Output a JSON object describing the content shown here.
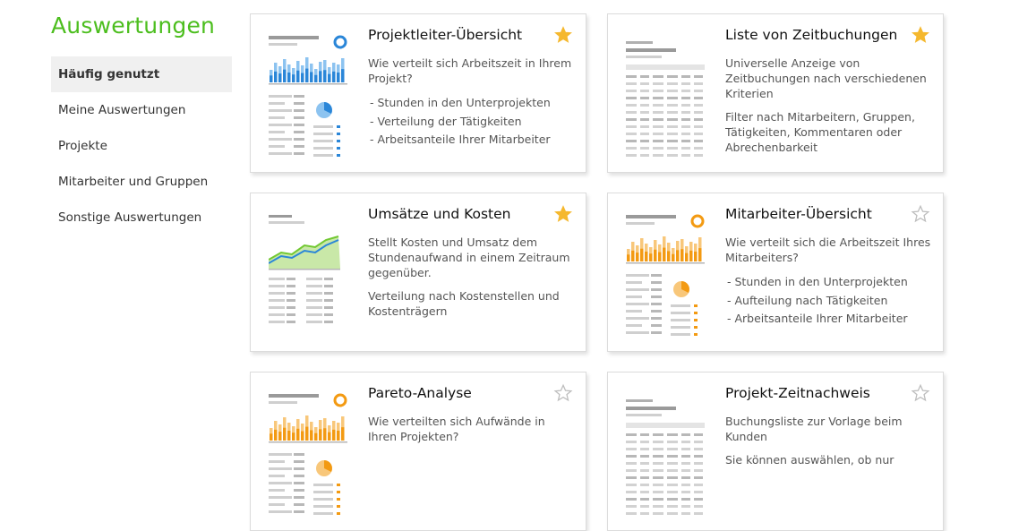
{
  "header": {
    "title": "Auswertungen"
  },
  "sidebar": {
    "items": [
      {
        "label": "Häufig genutzt",
        "active": true
      },
      {
        "label": "Meine Auswertungen"
      },
      {
        "label": "Projekte"
      },
      {
        "label": "Mitarbeiter und Gruppen"
      },
      {
        "label": "Sonstige Auswertungen"
      }
    ]
  },
  "colors": {
    "brand_green": "#4cbe1e",
    "star_gold": "#f5b82e",
    "thumb_blue": "#2a86d8",
    "thumb_orange": "#f39a12",
    "thumb_green": "#72c832"
  },
  "cards": [
    {
      "title": "Projektleiter-Übersicht",
      "favorite": true,
      "thumb": "bar-blue",
      "description": "Wie verteilt sich Arbeitszeit in Ihrem Projekt?",
      "bullets": [
        "- Stunden in den Unterprojekten",
        "- Verteilung der Tätigkeiten",
        "- Arbeitsanteile Ihrer Mitarbeiter"
      ]
    },
    {
      "title": "Liste von Zeitbuchungen",
      "favorite": true,
      "thumb": "list",
      "description": "Universelle Anzeige von Zeitbuchungen nach verschiedenen Kriterien",
      "description2": "Filter nach Mitarbeitern, Gruppen, Tätigkeiten, Kommentaren oder Abrechenbarkeit"
    },
    {
      "title": "Umsätze und Kosten",
      "favorite": true,
      "thumb": "area-green",
      "description": "Stellt Kosten und Umsatz dem Stundenaufwand in einem Zeitraum gegenüber.",
      "description2": "Verteilung nach Kostenstellen und Kostenträgern"
    },
    {
      "title": "Mitarbeiter-Übersicht",
      "favorite": false,
      "thumb": "bar-orange",
      "description": "Wie verteilt sich die Arbeitszeit Ihres Mitarbeiters?",
      "bullets": [
        "- Stunden in den Unterprojekten",
        "- Aufteilung nach Tätigkeiten",
        "- Arbeitsanteile Ihrer Mitarbeiter"
      ]
    },
    {
      "title": "Pareto-Analyse",
      "favorite": false,
      "thumb": "bar-orange",
      "description": "Wie verteilten sich Aufwände in Ihren Projekten?"
    },
    {
      "title": "Projekt-Zeitnachweis",
      "favorite": false,
      "thumb": "list",
      "description": "Buchungsliste zur Vorlage beim Kunden",
      "description2": "Sie können auswählen, ob nur"
    }
  ]
}
